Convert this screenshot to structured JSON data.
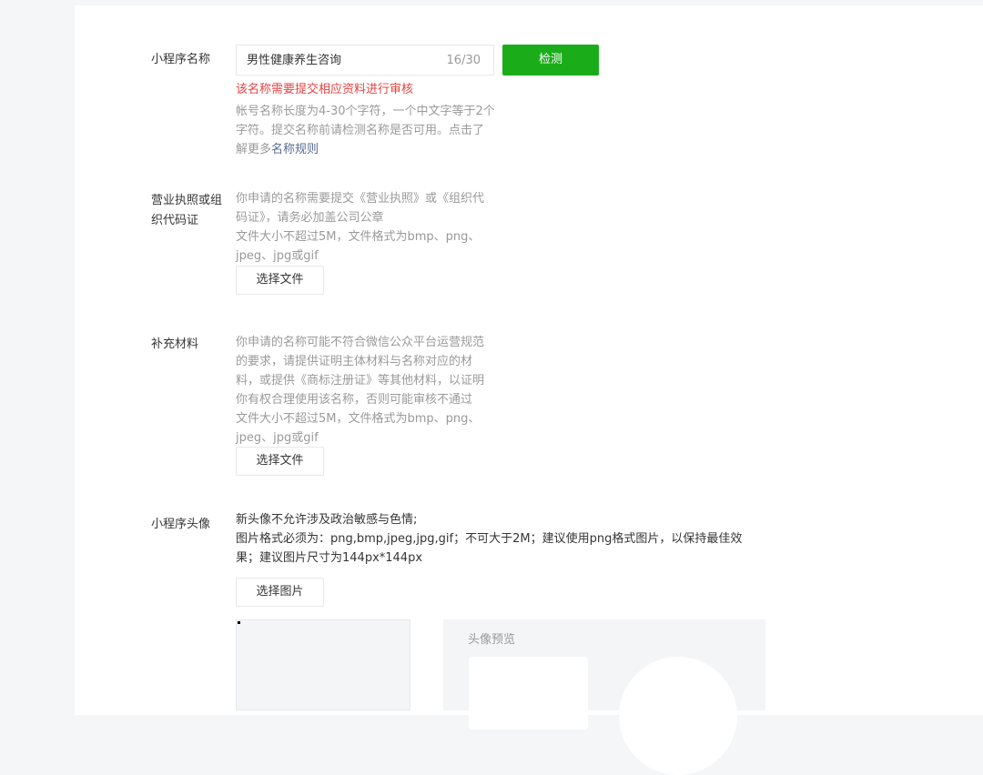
{
  "name_section": {
    "label": "小程序名称",
    "input_value": "男性健康养生咨询",
    "counter": "16/30",
    "check_button": "检测",
    "error": "该名称需要提交相应资料进行审核",
    "hint_text": "帐号名称长度为4-30个字符，一个中文字等于2个字符。提交名称前请检测名称是否可用。点击了解更多",
    "hint_link": "名称规则"
  },
  "license_section": {
    "label": "营业执照或组织代码证",
    "hint": "你申请的名称需要提交《营业执照》或《组织代码证》，请务必加盖公司公章\n文件大小不超过5M，文件格式为bmp、png、jpeg、jpg或gif",
    "button": "选择文件"
  },
  "supplement_section": {
    "label": "补充材料",
    "hint": "你申请的名称可能不符合微信公众平台运营规范的要求，请提供证明主体材料与名称对应的材料，或提供《商标注册证》等其他材料，以证明你有权合理使用该名称，否则可能审核不通过\n文件大小不超过5M，文件格式为bmp、png、jpeg、jpg或gif",
    "button": "选择文件"
  },
  "avatar_section": {
    "label": "小程序头像",
    "rule_line1": "新头像不允许涉及政治敏感与色情;",
    "rule_line2": "图片格式必须为：png,bmp,jpeg,jpg,gif；不可大于2M；建议使用png格式图片，以保持最佳效果；建议图片尺寸为144px*144px",
    "button": "选择图片",
    "preview_title": "头像预览"
  },
  "colors": {
    "primary": "#1aad19",
    "error": "#e64340",
    "link": "#576b95",
    "hint": "#9a9a9a"
  }
}
